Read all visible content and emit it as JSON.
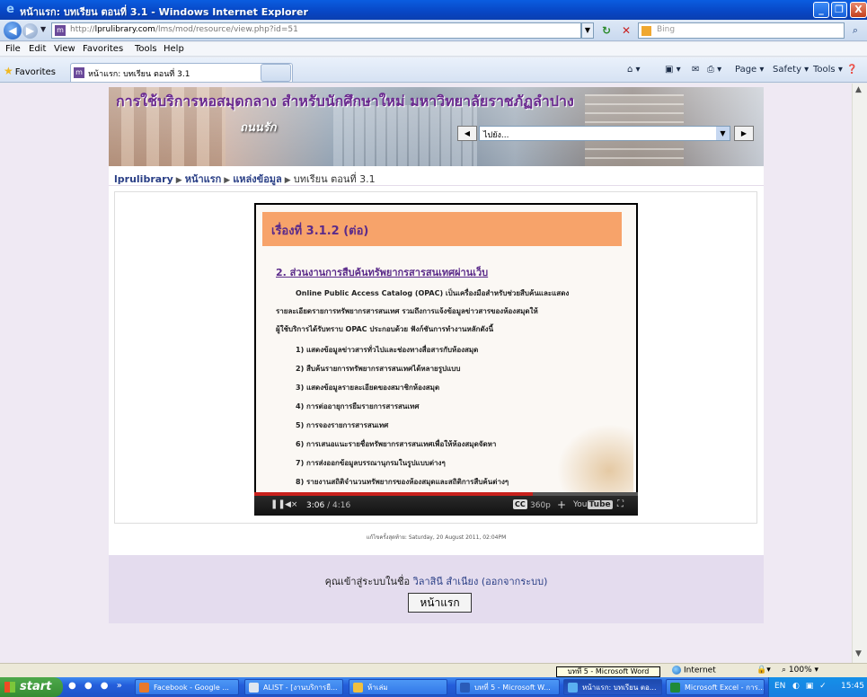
{
  "window": {
    "title": "หน้าแรก: บทเรียน ตอนที่ 3.1 - Windows Internet Explorer",
    "min": "_",
    "max": "❐",
    "close": "X"
  },
  "address": {
    "url_prefix": "http://",
    "url_host": "lprulibrary.com",
    "url_path": "/lms/mod/resource/view.php?id=51",
    "search_placeholder": "Bing"
  },
  "menu": [
    "File",
    "Edit",
    "View",
    "Favorites",
    "Tools",
    "Help"
  ],
  "favorites_bar": {
    "favorites_label": "Favorites",
    "tab_label": "หน้าแรก: บทเรียน ตอนที่ 3.1"
  },
  "commandbar": {
    "page": "Page ▾",
    "safety": "Safety ▾",
    "tools": "Tools ▾"
  },
  "site": {
    "title": "การใช้บริการหอสมุดกลาง สำหรับนักศึกษาใหม่ มหาวิทยาลัยราชภัฏลำปาง",
    "banner_logo_text": "ถนนรัก",
    "jump_value": "ไปยัง...",
    "breadcrumb": [
      "lprulibrary",
      "หน้าแรก",
      "แหล่งข้อมูล",
      "บทเรียน ตอนที่ 3.1"
    ]
  },
  "slide": {
    "heading": "เรื่องที่ 3.1.2 (ต่อ)",
    "subheading": "2.  ส่วนงานการสืบค้นทรัพยากรสารสนเทศผ่านเว็บ",
    "paragraph": [
      "Online Public Access Catalog (OPAC) เป็นเครื่องมือสำหรับช่วยสืบค้นและแสดง",
      "รายละเอียดรายการทรัพยากรสารสนเทศ รวมถึงการแจ้งข้อมูลข่าวสารของห้องสมุดให้",
      "ผู้ใช้บริการได้รับทราบ OPAC ประกอบด้วย ฟังก์ชันการทำงานหลักดังนี้"
    ],
    "items": [
      "1)  แสดงข้อมูลข่าวสารทั่วไปและช่องทางสื่อสารกับห้องสมุด",
      "2)  สืบค้นรายการทรัพยากรสารสนเทศได้หลายรูปแบบ",
      "3)  แสดงข้อมูลรายละเอียดของสมาชิกห้องสมุด",
      "4)  การต่ออายุการยืมรายการสารสนเทศ",
      "5)  การจองรายการสารสนเทศ",
      "6)  การเสนอแนะรายชื่อทรัพยากรสารสนเทศเพื่อให้ห้องสมุดจัดหา",
      "7)  การส่งออกข้อมูลบรรณานุกรมในรูปแบบต่างๆ",
      "8)  รายงานสถิติจำนวนทรัพยากรของห้องสมุดและสถิติการสืบค้นต่างๆ"
    ]
  },
  "player": {
    "current_time": "3:06",
    "duration": "/ 4:16",
    "progress_fraction": 0.727,
    "cc": "CC",
    "quality": "360p",
    "youtube": "You",
    "youtube_tube": "Tube"
  },
  "last_modified": "แก้ไขครั้งสุดท้าย: Saturday, 20 August 2011, 02:04PM",
  "footer": {
    "login_prefix": "คุณเข้าสู่ระบบในชื่อ ",
    "user_name": "วิลาสินี สำเนียง",
    "logout": "(ออกจากระบบ)",
    "home_button": "หน้าแรก"
  },
  "statusbar": {
    "zone": "Internet",
    "zoom": "100%",
    "tooltip": "บทที่ 5 - Microsoft Word"
  },
  "taskbar": {
    "start": "start",
    "tasks": [
      {
        "label": "Facebook - Google ...",
        "color": "#e8792a"
      },
      {
        "label": "ALIST - [งานบริการยื...",
        "color": "#dfe6ef"
      },
      {
        "label": "ห้าเล่ม",
        "color": "#f0c040"
      },
      {
        "label": "บทที่ 5 - Microsoft W...",
        "color": "#2a5bb8"
      },
      {
        "label": "หน้าแรก: บทเรียน ตอ...",
        "color": "#5ab0f0"
      },
      {
        "label": "Microsoft Excel - การ...",
        "color": "#1f8a3a"
      }
    ],
    "lang": "EN",
    "clock": "15:45"
  },
  "colors": {
    "site_title": "#6a2a8f",
    "link": "#2a3f86",
    "slide_header": "#f7a36a",
    "progress": "#c8201c"
  }
}
